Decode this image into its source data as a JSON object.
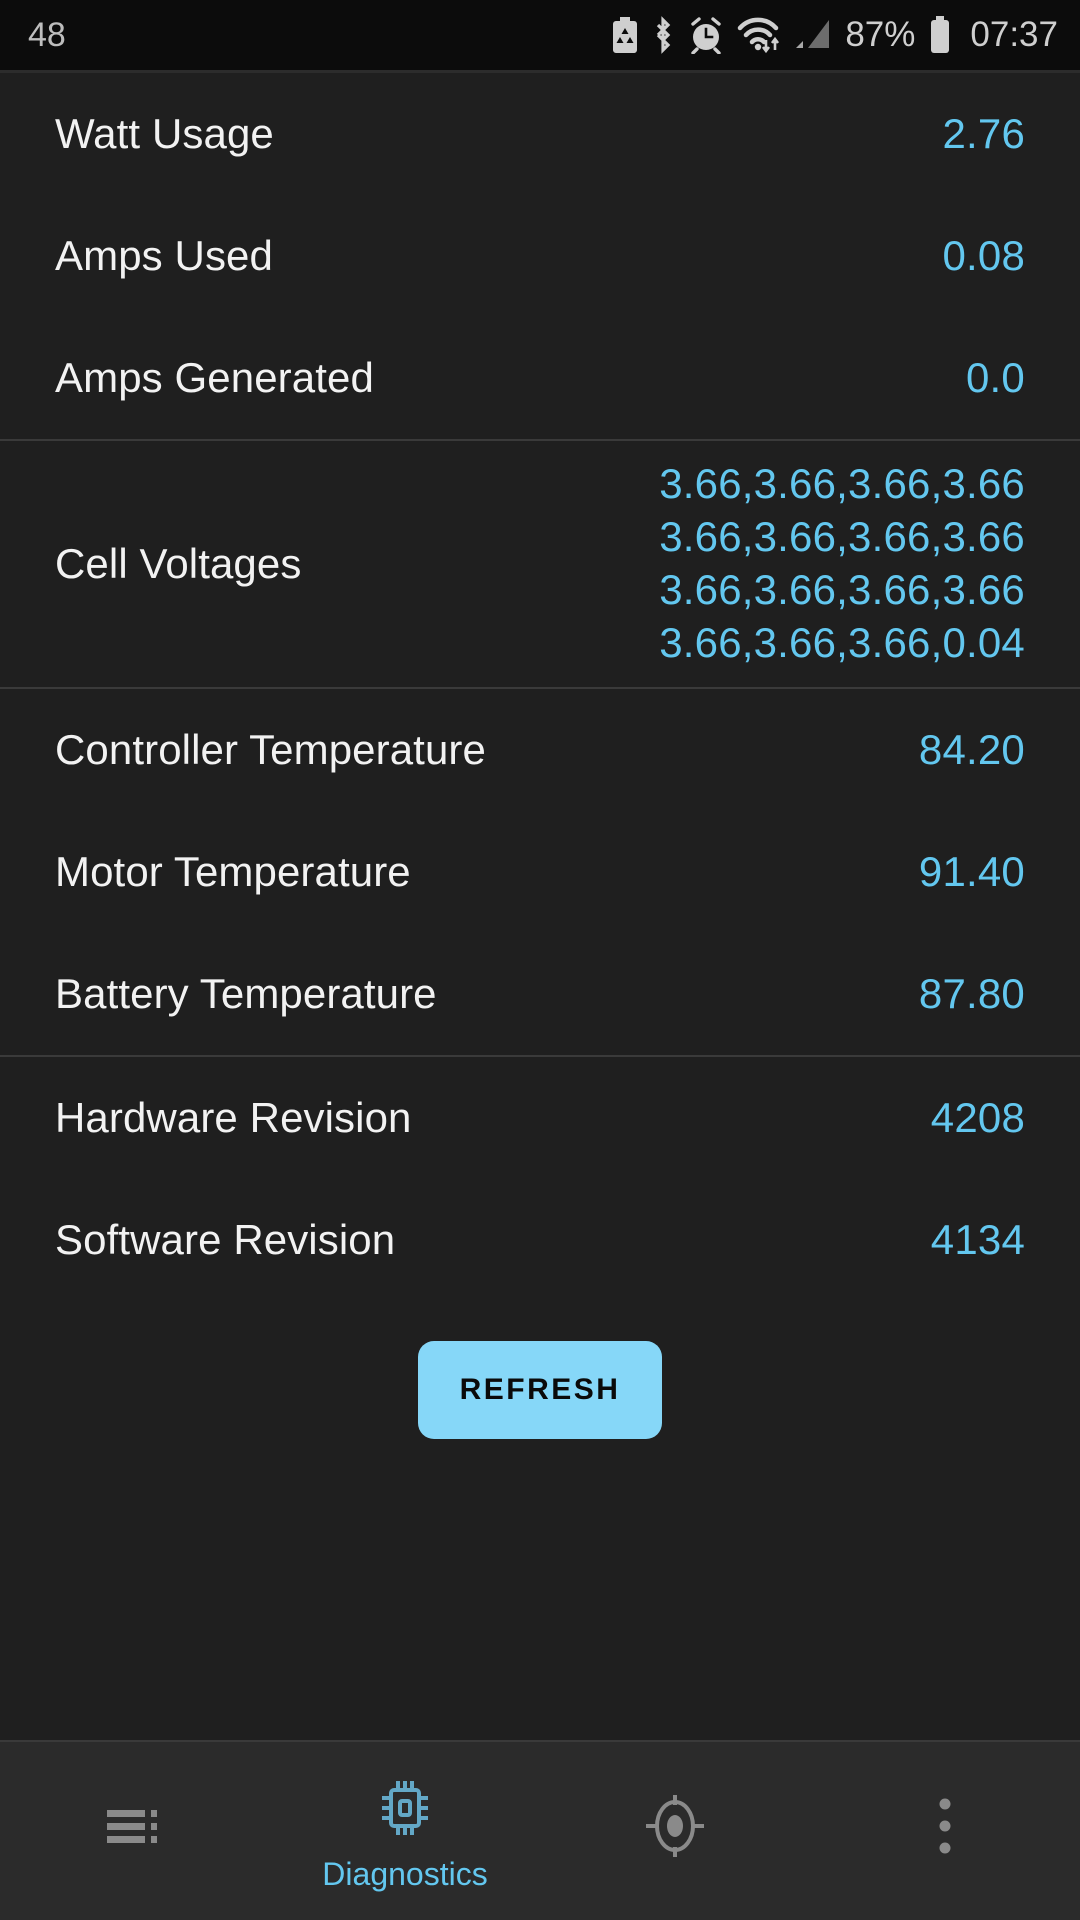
{
  "statusbar": {
    "left_text": "48",
    "icons": [
      {
        "name": "battery-saver-icon"
      },
      {
        "name": "bluetooth-icon"
      },
      {
        "name": "alarm-clock-icon"
      },
      {
        "name": "wifi-icon"
      },
      {
        "name": "cellular-signal-icon"
      }
    ],
    "battery_percent": "87%",
    "battery_icon": "battery-full-icon",
    "time": "07:37"
  },
  "colors": {
    "accent": "#63c7ef",
    "button_bg": "#86d7f8",
    "background": "#1f1f1f",
    "statusbar_bg": "#0c0c0c",
    "navbar_bg": "#2b2b2b",
    "label_text": "#f2f2f2",
    "divider": "#3a3a3a"
  },
  "groups": [
    {
      "rows": [
        {
          "label": "Watt Usage",
          "value": "2.76"
        },
        {
          "label": "Amps Used",
          "value": "0.08"
        },
        {
          "label": "Amps Generated",
          "value": "0.0"
        }
      ]
    },
    {
      "rows": [
        {
          "label": "Cell Voltages",
          "value": "3.66,3.66,3.66,3.66\n3.66,3.66,3.66,3.66\n3.66,3.66,3.66,3.66\n3.66,3.66,3.66,0.04",
          "multiline": true
        }
      ]
    },
    {
      "rows": [
        {
          "label": "Controller Temperature",
          "value": "84.20"
        },
        {
          "label": "Motor Temperature",
          "value": "91.40"
        },
        {
          "label": "Battery Temperature",
          "value": "87.80"
        }
      ]
    },
    {
      "rows": [
        {
          "label": "Hardware Revision",
          "value": "4208"
        },
        {
          "label": "Software Revision",
          "value": "4134"
        }
      ]
    }
  ],
  "refresh": {
    "label": "REFRESH"
  },
  "navbar": {
    "items": [
      {
        "icon": "list-menu-icon",
        "label": "",
        "active": false
      },
      {
        "icon": "cpu-chip-icon",
        "label": "Diagnostics",
        "active": true
      },
      {
        "icon": "gps-target-icon",
        "label": "",
        "active": false
      },
      {
        "icon": "overflow-menu-icon",
        "label": "",
        "active": false
      }
    ]
  }
}
